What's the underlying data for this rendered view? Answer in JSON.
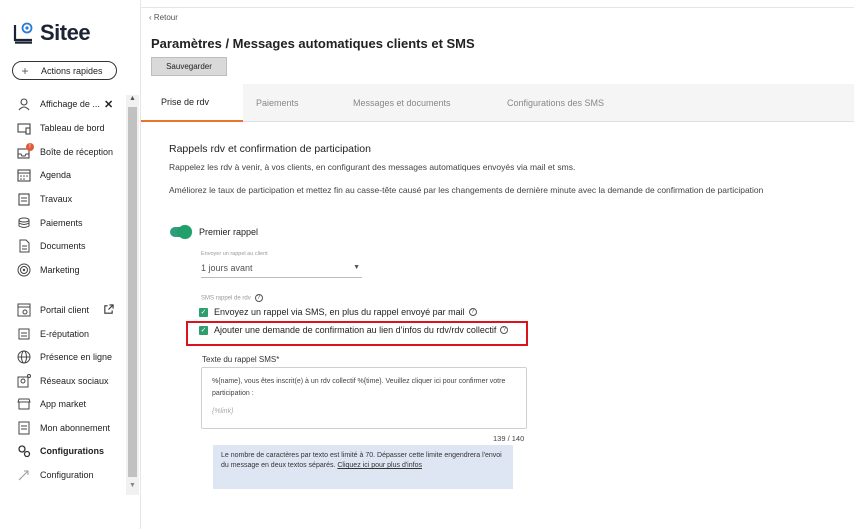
{
  "brand": {
    "name": "Sitee"
  },
  "quick_actions": {
    "label": "Actions rapides"
  },
  "sidebar": {
    "items": [
      {
        "label": "Affichage de ...",
        "icon": "users-icon"
      },
      {
        "label": "Tableau de bord",
        "icon": "dashboard-icon"
      },
      {
        "label": "Boîte de réception",
        "icon": "inbox-icon",
        "badge": "!"
      },
      {
        "label": "Agenda",
        "icon": "calendar-icon"
      },
      {
        "label": "Travaux",
        "icon": "clipboard-icon"
      },
      {
        "label": "Paiements",
        "icon": "coins-icon"
      },
      {
        "label": "Documents",
        "icon": "document-icon"
      },
      {
        "label": "Marketing",
        "icon": "target-icon"
      },
      {
        "label": "Portail client",
        "icon": "portal-icon"
      },
      {
        "label": "E-réputation",
        "icon": "star-list-icon"
      },
      {
        "label": "Présence en ligne",
        "icon": "globe-icon"
      },
      {
        "label": "Réseaux sociaux",
        "icon": "social-icon"
      },
      {
        "label": "App market",
        "icon": "store-icon"
      },
      {
        "label": "Mon abonnement",
        "icon": "subscription-icon"
      },
      {
        "label": "Configurations",
        "icon": "gears-icon"
      },
      {
        "label": "Configuration",
        "icon": "rocket-icon"
      }
    ]
  },
  "header": {
    "back_label": "Retour",
    "title": "Paramètres / Messages automatiques clients et SMS",
    "save_label": "Sauvegarder"
  },
  "tabs": [
    {
      "label": "Prise de rdv",
      "active": true
    },
    {
      "label": "Paiements",
      "active": false
    },
    {
      "label": "Messages et documents",
      "active": false
    },
    {
      "label": "Configurations des SMS",
      "active": false
    }
  ],
  "section": {
    "title": "Rappels rdv et confirmation de participation",
    "desc1": "Rappelez les rdv à venir, à vos clients, en configurant des messages automatiques envoyés via mail et sms.",
    "desc2": "Améliorez le taux de participation et mettez fin au casse-tête causé par les changements de dernière minute avec la demande de confirmation de participation"
  },
  "reminder": {
    "toggle_label": "Premier rappel",
    "toggle_on": true,
    "send_label": "Envoyer un rappel au client",
    "send_value": "1 jours avant",
    "sms_section_label": "SMS rappel de rdv",
    "checkbox1": "Envoyez un rappel via SMS, en plus du rappel envoyé par mail",
    "checkbox2": "Ajouter une demande de confirmation au lien d'infos du rdv/rdv collectif",
    "sms_text_label": "Texte du rappel SMS*",
    "sms_text": "%{name},  vous êtes inscrit(e) à un rdv collectif %{time}. Veuillez cliquer ici pour confirmer votre participation :",
    "sms_placeholder": "{%link}",
    "counter": "139 / 140",
    "info_text": "Le nombre de caractères par texto est limité à 70. Dépasser cette limite engendrera l'envoi du message en deux textos séparés. ",
    "info_link": "Cliquez ici pour plus d'infos"
  },
  "colors": {
    "accent": "#e8742e",
    "toggle": "#22a06b",
    "highlight": "#d9151b",
    "info_bg": "#dfe6f3"
  }
}
